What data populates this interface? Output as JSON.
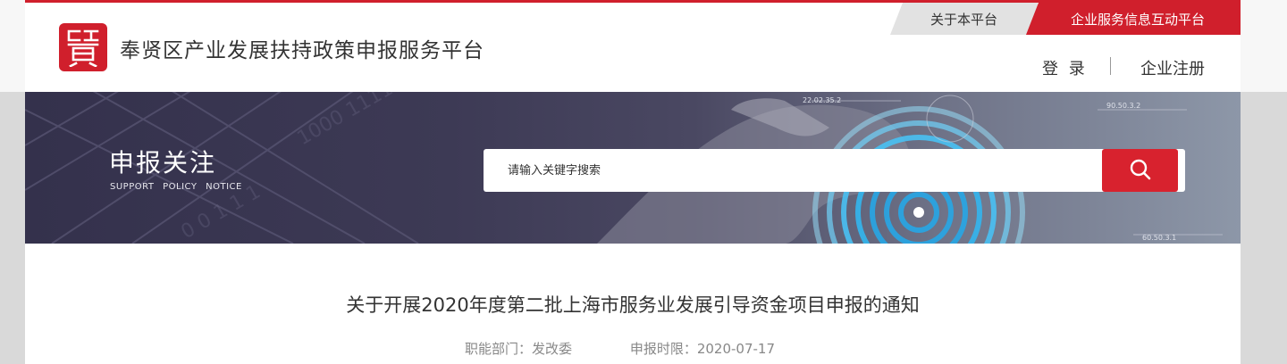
{
  "header": {
    "site_title": "奉贤区产业发展扶持政策申报服务平台",
    "logo_icon": "seal-logo-icon",
    "top_links": {
      "about": "关于本平台",
      "interaction": "企业服务信息互动平台"
    },
    "nav": {
      "login": "登 录",
      "register": "企业注册"
    }
  },
  "banner": {
    "title": "申报关注",
    "subtitle": "SUPPORT POLICY NOTICE",
    "art_labels": [
      "22.02.35.2",
      "90.50.3.2",
      "60.50.3.1"
    ]
  },
  "search": {
    "placeholder": "请输入关键字搜索",
    "value": "",
    "button_icon": "search-icon"
  },
  "article": {
    "title": "关于开展2020年度第二批上海市服务业发展引导资金项目申报的通知",
    "department_label": "职能部门：",
    "department": "发改委",
    "date_label": "申报时限：",
    "date": "2020-07-17"
  },
  "colors": {
    "brand_red": "#d01f2c",
    "banner_dark": "#34314c",
    "text": "#333333",
    "muted": "#888888"
  }
}
